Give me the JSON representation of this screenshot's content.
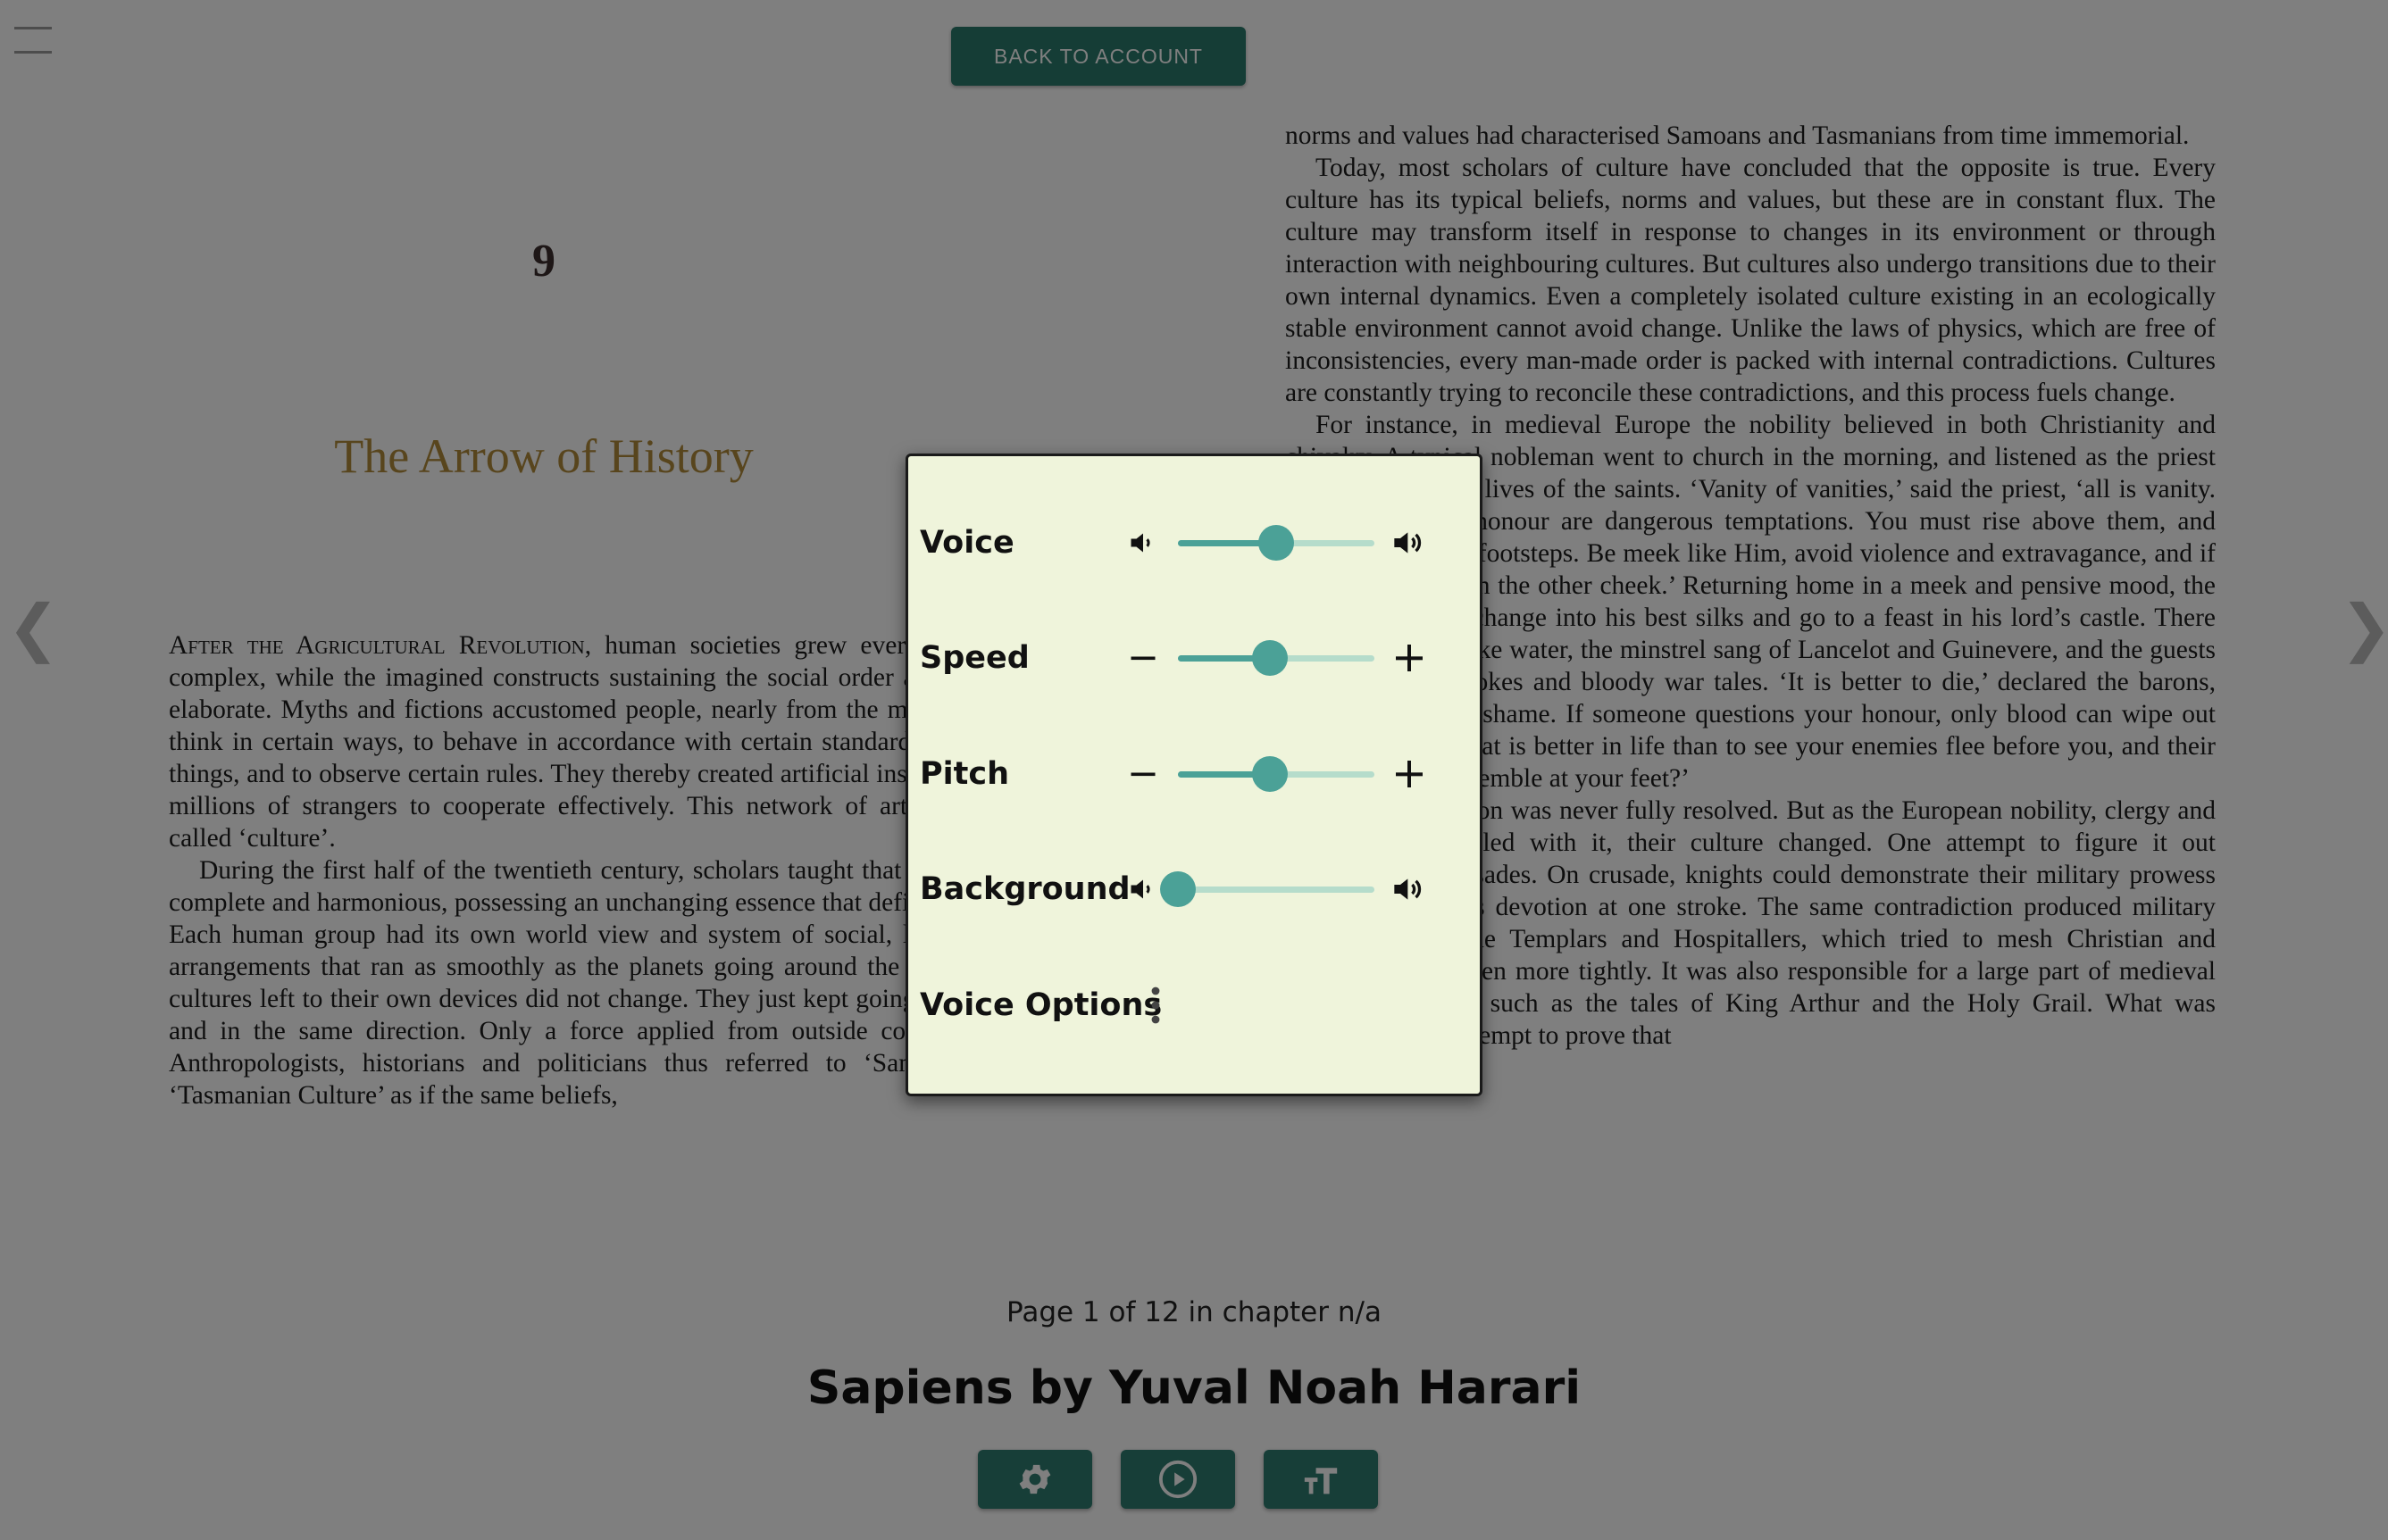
{
  "header": {
    "back_button_label": "BACK TO ACCOUNT"
  },
  "icons": {
    "menu": "hamburger-icon",
    "prev": "chevron-left-icon",
    "next": "chevron-right-icon",
    "settings": "gear-icon",
    "play": "play-circle-icon",
    "text_size": "text-size-icon",
    "volume_low": "speaker-low-icon",
    "volume_high": "speaker-high-icon",
    "minus": "minus-icon",
    "plus": "plus-icon",
    "more": "vertical-dots-icon"
  },
  "colors": {
    "accent": "#2e7c70",
    "slider": "#4ba197",
    "slider_track": "#b5dccb",
    "panel_bg": "#eff4db",
    "chapter_title": "#b08a3a"
  },
  "book": {
    "chapter_number": "9",
    "chapter_title": "The Arrow of History",
    "left_paragraphs": [
      {
        "opening": "After the Agricultural Revolution,",
        "text": " human societies grew ever larger and more complex, while the imagined constructs sustaining the social order also became more elaborate. Myths and fictions accustomed people, nearly from the moment of birth, to think in certain ways, to behave in accordance with certain standards, to want certain things, and to observe certain rules. They thereby created artificial instincts that enabled millions of strangers to cooperate effectively. This network of artificial instincts is called ‘culture’."
      },
      {
        "opening": "",
        "text": "During the first half of the twentieth century, scholars taught that every culture was complete and harmonious, possessing an unchanging essence that defined it for all time. Each human group had its own world view and system of social, legal and political arrangements that ran as smoothly as the planets going around the sun. In this view, cultures left to their own devices did not change. They just kept going at the same pace and in the same direction. Only a force applied from outside could change them. Anthropologists, historians and politicians thus referred to ‘Samoan Culture’ or ‘Tasmanian Culture’ as if the same beliefs,"
      }
    ],
    "right_paragraphs": [
      {
        "indent": false,
        "text": "norms and values had characterised Samoans and Tasmanians from time immemorial."
      },
      {
        "indent": true,
        "text": "Today, most scholars of culture have concluded that the opposite is true. Every culture has its typical beliefs, norms and values, but these are in constant flux. The culture may transform itself in response to changes in its environment or through interaction with neighbouring cultures. But cultures also undergo transitions due to their own internal dynamics. Even a completely isolated culture existing in an ecologically stable environment cannot avoid change. Unlike the laws of physics, which are free of inconsistencies, every man-made order is packed with internal contradictions. Cultures are constantly trying to reconcile these contradictions, and this process fuels change."
      },
      {
        "indent": true,
        "text": "For instance, in medieval Europe the nobility believed in both Christianity and chivalry. A typical nobleman went to church in the morning, and listened as the priest expounded on the lives of the saints. ‘Vanity of vanities,’ said the priest, ‘all is vanity. Riches, lust and honour are dangerous temptations. You must rise above them, and follow in Christ’s footsteps. Be meek like Him, avoid violence and extravagance, and if attacked – just turn the other cheek.’ Returning home in a meek and pensive mood, the nobleman would change into his best silks and go to a feast in his lord’s castle. There the wine flowed like water, the minstrel sang of Lancelot and Guinevere, and the guests exchanged dirty jokes and bloody war tales. ‘It is better to die,’ declared the barons, ‘than to live with shame. If someone questions your honour, only blood can wipe out the insult. And what is better in life than to see your enemies flee before you, and their pretty daughters tremble at your feet?’"
      },
      {
        "indent": true,
        "text": "The contradiction was never fully resolved. But as the European nobility, clergy and commoners grappled with it, their culture changed. One attempt to figure it out produced the Crusades. On crusade, knights could demonstrate their military prowess and their religious devotion at one stroke. The same contradiction produced military orders such as the Templars and Hospitallers, which tried to mesh Christian and chivalric ideals even more tightly. It was also responsible for a large part of medieval art and literature, such as the tales of King Arthur and the Holy Grail. What was Camelot but an attempt to prove that"
      }
    ]
  },
  "footer": {
    "page_indicator": "Page 1 of 12 in chapter n/a",
    "book_title": "Sapiens by Yuval Noah Harari"
  },
  "audio_panel": {
    "voice": {
      "label": "Voice",
      "value": 0.5
    },
    "speed": {
      "label": "Speed",
      "value": 0.47
    },
    "pitch": {
      "label": "Pitch",
      "value": 0.47
    },
    "background": {
      "label": "Background",
      "value": 0.0
    },
    "voice_options": {
      "label": "Voice Options"
    }
  }
}
